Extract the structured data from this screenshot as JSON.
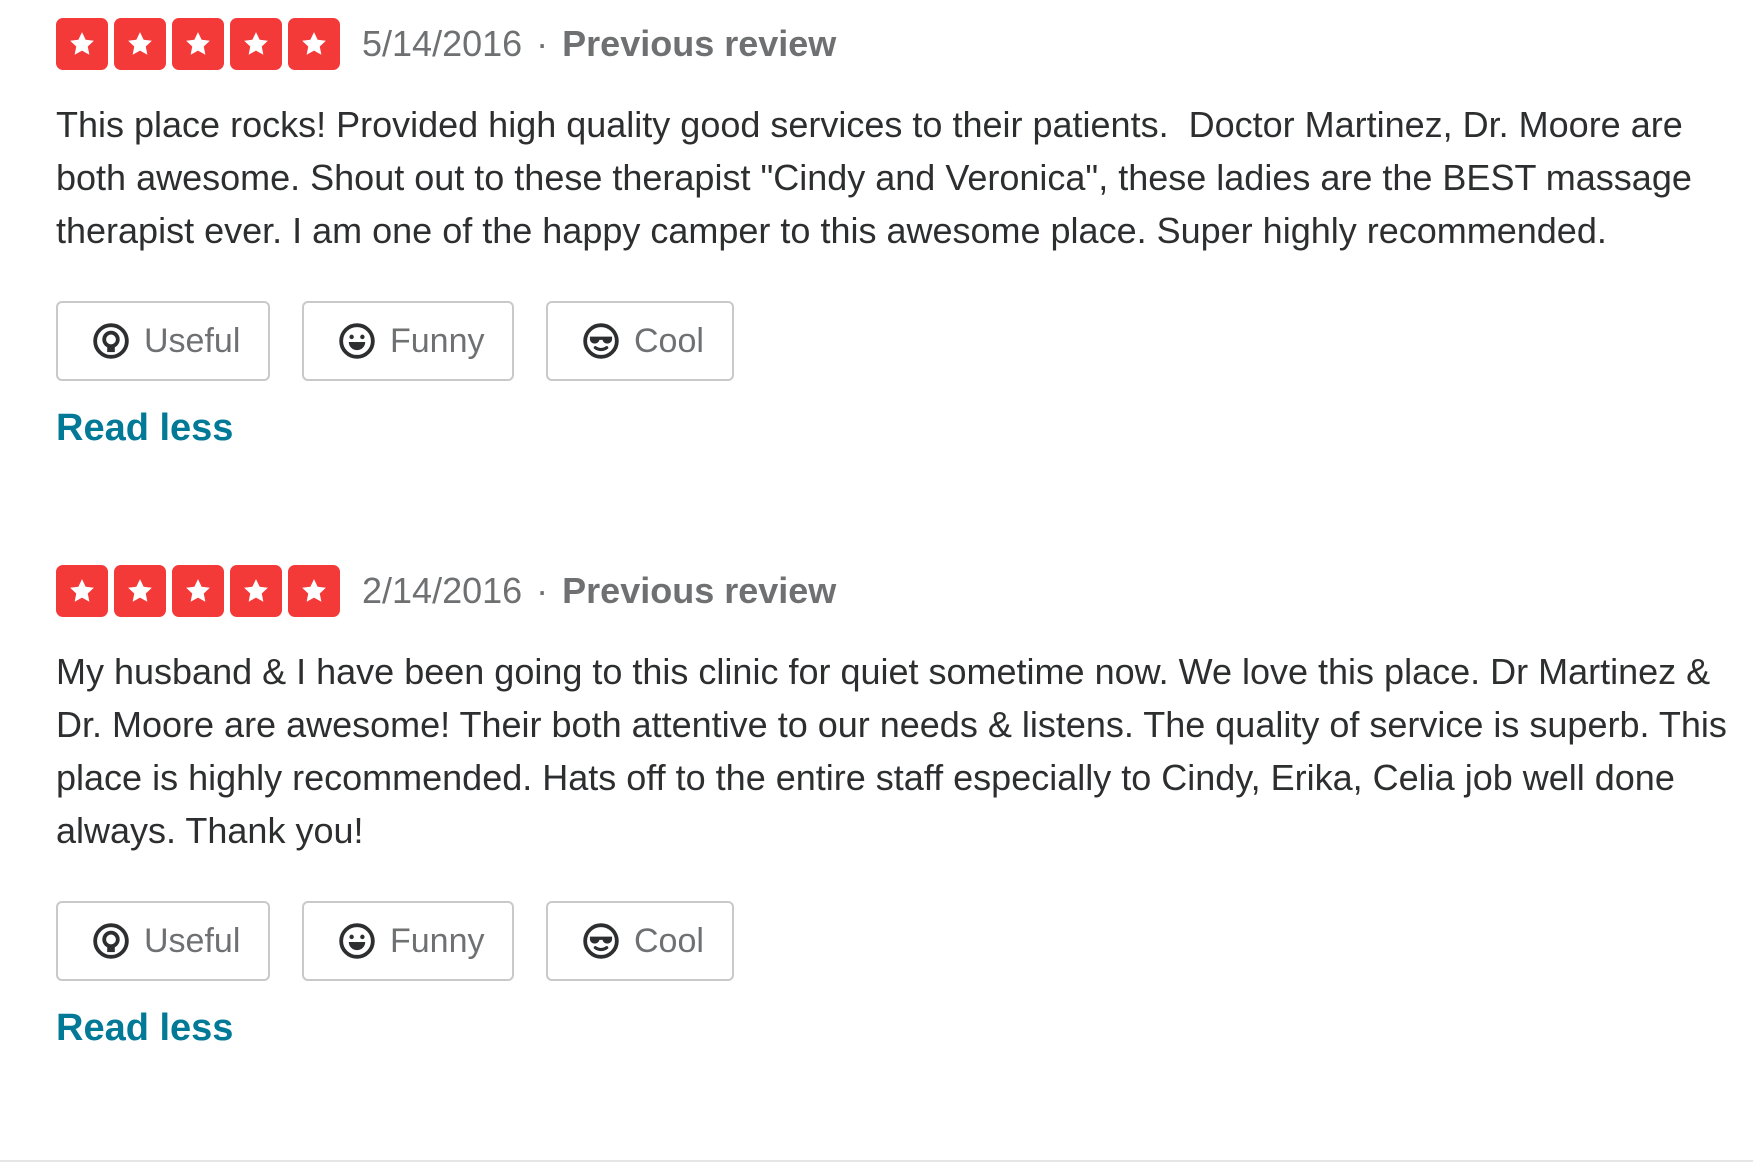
{
  "colors": {
    "star_bg": "#f43939",
    "meta_text": "#6e7072",
    "body_text": "#2d2e2f",
    "link": "#027a97",
    "button_border": "#c8c9ca"
  },
  "reviews": [
    {
      "rating": 5,
      "date": "5/14/2016",
      "separator": "·",
      "status": "Previous review",
      "text": "This place rocks! Provided high quality good services to their patients.  Doctor Martinez, Dr. Moore are both awesome. Shout out to these therapist \"Cindy and Veronica\", these ladies are the BEST massage therapist ever. I am one of the happy camper to this awesome place. Super highly recommended.",
      "actions": {
        "useful": "Useful",
        "funny": "Funny",
        "cool": "Cool"
      },
      "read_less": "Read less"
    },
    {
      "rating": 5,
      "date": "2/14/2016",
      "separator": "·",
      "status": "Previous review",
      "text": "My husband & I have been going to this clinic for quiet sometime now. We love this place. Dr Martinez & Dr. Moore are awesome! Their both attentive to our needs & listens. The quality of service is superb. This place is highly recommended. Hats off to the entire staff especially to Cindy, Erika, Celia job well done always. Thank you!",
      "actions": {
        "useful": "Useful",
        "funny": "Funny",
        "cool": "Cool"
      },
      "read_less": "Read less"
    }
  ],
  "icons": {
    "star": "star-icon",
    "useful": "lightbulb-icon",
    "funny": "smiley-icon",
    "cool": "sunglasses-icon"
  }
}
